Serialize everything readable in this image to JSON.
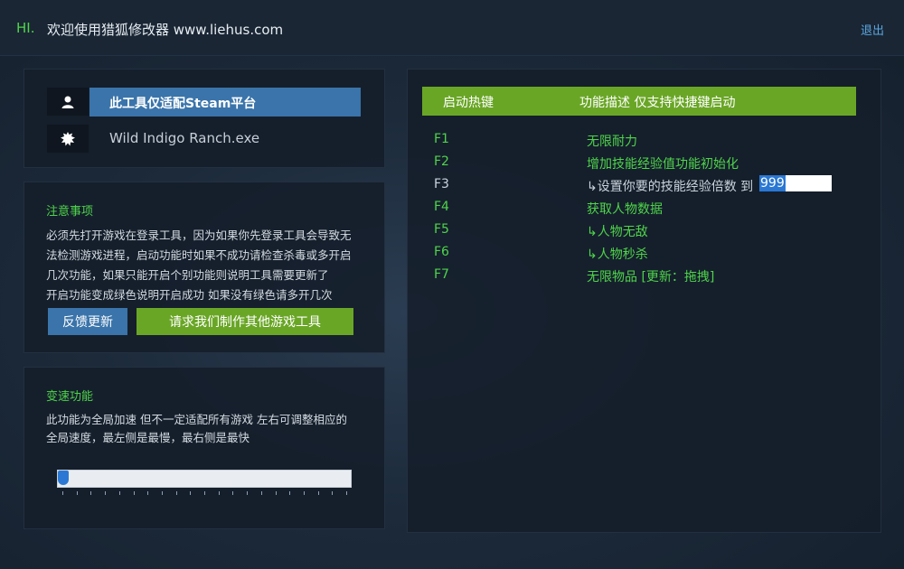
{
  "topbar": {
    "hi": "HI.",
    "welcome": "欢迎使用猎狐修改器 www.liehus.com",
    "logout": "退出"
  },
  "info": {
    "steam_label": "此工具仅适配Steam平台",
    "exe_name": "Wild Indigo Ranch.exe",
    "user_icon": "user-icon",
    "gear_icon": "gear-icon"
  },
  "notice": {
    "title": "注意事项",
    "lines": [
      "必须先打开游戏在登录工具，因为如果你先登录工具会导致无",
      "法检测游戏进程，启动功能时如果不成功请检查杀毒或多开启",
      "几次功能，如果只能开启个别功能则说明工具需要更新了",
      "开启功能变成绿色说明开启成功 如果没有绿色请多开几次"
    ],
    "feedback_btn": "反馈更新",
    "request_btn": "请求我们制作其他游戏工具"
  },
  "speed": {
    "title": "变速功能",
    "lines": [
      "此功能为全局加速 但不一定适配所有游戏 左右可调整相应的",
      "全局速度，最左侧是最慢，最右侧是最快"
    ],
    "slider_value": 0
  },
  "hotkeys": {
    "header_key": "启动热键",
    "header_desc": "功能描述 仅支持快捷键启动",
    "rows": [
      {
        "key": "F1",
        "desc": "无限耐力"
      },
      {
        "key": "F2",
        "desc": "增加技能经验值功能初始化"
      },
      {
        "key": "F3",
        "desc": "↳设置你要的技能经验倍数 到",
        "input": "999"
      },
      {
        "key": "F4",
        "desc": "获取人物数据"
      },
      {
        "key": "F5",
        "desc": "↳人物无敌"
      },
      {
        "key": "F6",
        "desc": "↳人物秒杀"
      },
      {
        "key": "F7",
        "desc": "无限物品 [更新：拖拽]"
      }
    ]
  },
  "colors": {
    "accent_green": "#4fd44a",
    "button_blue": "#3a74aa",
    "button_green": "#6aa626"
  }
}
